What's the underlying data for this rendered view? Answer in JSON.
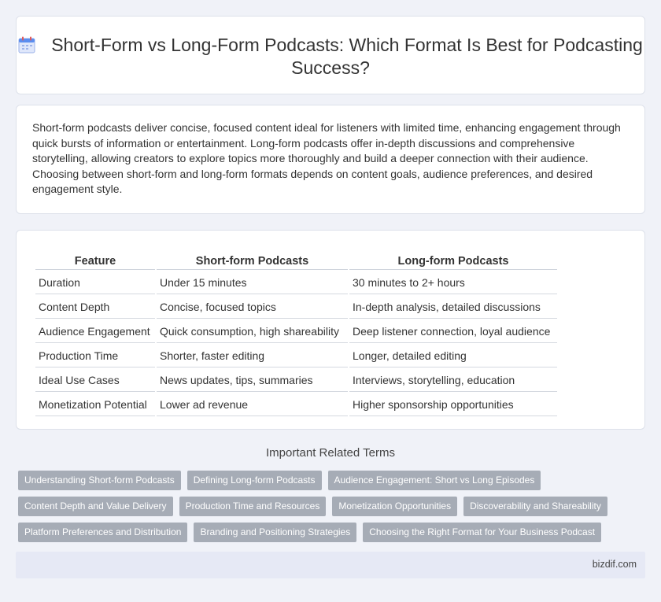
{
  "header": {
    "icon": "calendar-icon",
    "title": "Short-Form vs Long-Form Podcasts: Which Format Is Best for Podcasting Success?"
  },
  "intro": {
    "text": "Short-form podcasts deliver concise, focused content ideal for listeners with limited time, enhancing engagement through quick bursts of information or entertainment. Long-form podcasts offer in-depth discussions and comprehensive storytelling, allowing creators to explore topics more thoroughly and build a deeper connection with their audience. Choosing between short-form and long-form formats depends on content goals, audience preferences, and desired engagement style."
  },
  "table": {
    "headers": [
      "Feature",
      "Short-form Podcasts",
      "Long-form Podcasts"
    ],
    "rows": [
      [
        "Duration",
        "Under 15 minutes",
        "30 minutes to 2+ hours"
      ],
      [
        "Content Depth",
        "Concise, focused topics",
        "In-depth analysis, detailed discussions"
      ],
      [
        "Audience Engagement",
        "Quick consumption, high shareability",
        "Deep listener connection, loyal audience"
      ],
      [
        "Production Time",
        "Shorter, faster editing",
        "Longer, detailed editing"
      ],
      [
        "Ideal Use Cases",
        "News updates, tips, summaries",
        "Interviews, storytelling, education"
      ],
      [
        "Monetization Potential",
        "Lower ad revenue",
        "Higher sponsorship opportunities"
      ]
    ]
  },
  "related": {
    "title": "Important Related Terms",
    "rows": [
      [
        "Understanding Short-form Podcasts",
        "Defining Long-form Podcasts",
        "Audience Engagement: Short vs Long Episodes"
      ],
      [
        "Content Depth and Value Delivery",
        "Production Time and Resources",
        "Monetization Opportunities",
        "Discoverability and Shareability"
      ],
      [
        "Platform Preferences and Distribution",
        "Branding and Positioning Strategies",
        "Choosing the Right Format for Your Business Podcast"
      ]
    ]
  },
  "footer": {
    "brand": "bizdif.com"
  },
  "colors": {
    "background": "#f0f2f8",
    "tag": "#a6acb6",
    "footer": "#e6e9f5",
    "icon_accent": "#e05a5a",
    "icon_blue": "#5b8def"
  }
}
